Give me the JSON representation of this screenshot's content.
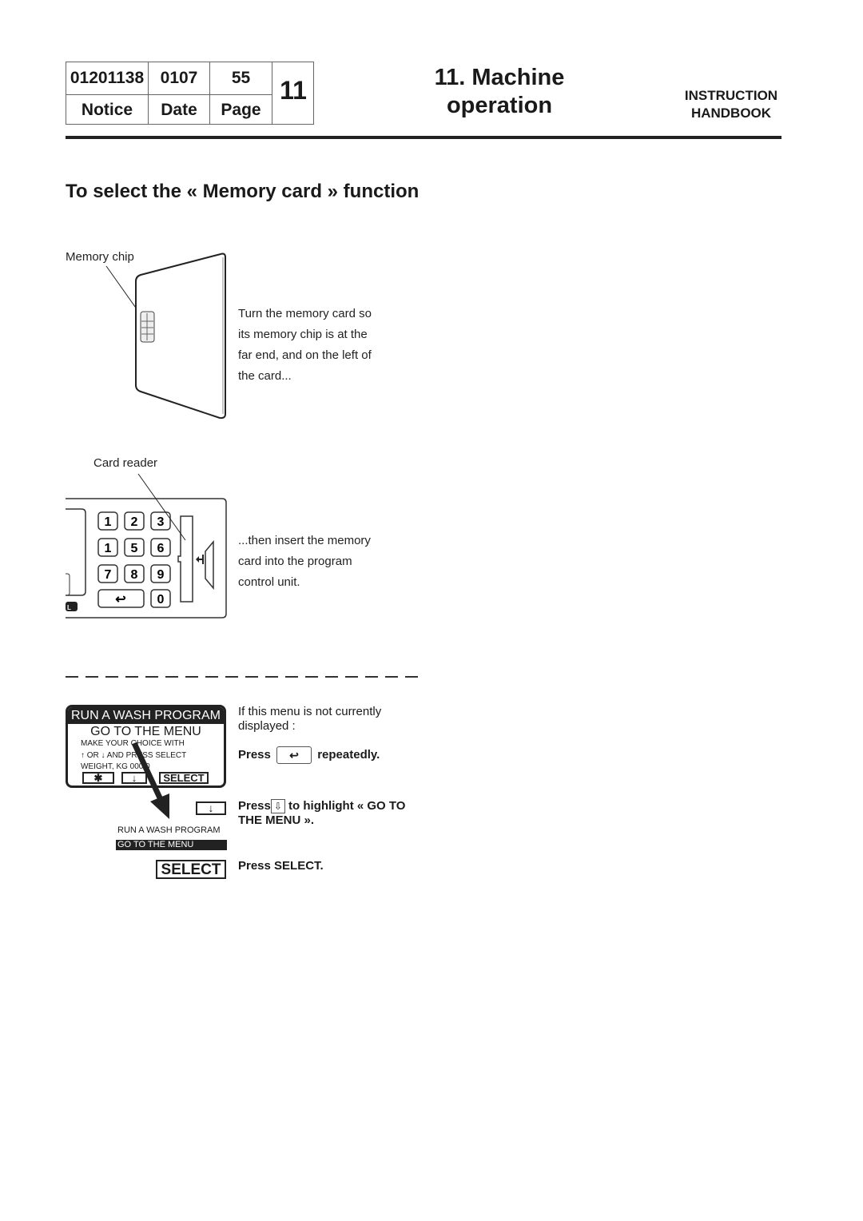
{
  "header": {
    "notice_number": "01201138",
    "date_value": "0107",
    "page_value": "55",
    "notice_label": "Notice",
    "date_label": "Date",
    "page_label": "Page",
    "chapter_number": "11",
    "chapter_title_line1": "11. Machine",
    "chapter_title_line2": "operation",
    "handbook_line1": "INSTRUCTION",
    "handbook_line2": "HANDBOOK"
  },
  "section_title": "To select the « Memory card » function",
  "step1": {
    "callout_label": "Memory chip",
    "description_lines": [
      "Turn the memory card so",
      "its memory chip is at the",
      "far end, and on the left of",
      "the card..."
    ]
  },
  "step2": {
    "callout_label": "Card reader",
    "keypad_keys": [
      "1",
      "2",
      "3",
      "1",
      "5",
      "6",
      "7",
      "8",
      "9",
      "↩",
      "0"
    ],
    "panel_tag": "L",
    "description_lines": [
      "...then insert the memory",
      "card into the program",
      "control unit."
    ]
  },
  "menu_steps": {
    "lcd": {
      "header": "RUN A WASH PROGRAM",
      "subheader": "GO TO THE MENU",
      "line1": "MAKE YOUR CHOICE WITH",
      "line2": "↑ OR ↓ AND PRESS SELECT",
      "line3": "WEIGHT, KG     000,0",
      "button_star": "✱",
      "button_down": "↓",
      "button_select": "SELECT"
    },
    "down_key_glyph": "↓",
    "mini_display_line1": "RUN A WASH PROGRAM",
    "mini_display_line2": "GO TO THE MENU",
    "select_key_label": "SELECT",
    "intro_line1": "If this menu is not currently",
    "intro_line2": "displayed :",
    "press_word": "Press",
    "return_key_glyph": "↩",
    "repeatedly": "repeatedly.",
    "down_outline_glyph": "⇩",
    "highlight_text_line1": "to highlight « GO TO",
    "highlight_text_line2": "THE MENU ».",
    "press_select": "Press SELECT."
  }
}
